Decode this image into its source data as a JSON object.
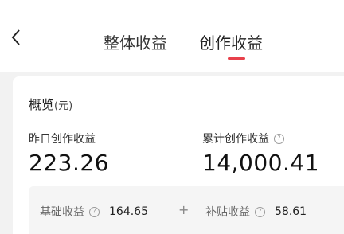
{
  "header": {
    "tabs": [
      {
        "label": "整体收益"
      },
      {
        "label": "创作收益"
      }
    ],
    "active_tab": 1,
    "accent_color": "#e8404b"
  },
  "overview": {
    "title": "概览",
    "unit": "(元)",
    "yesterday_label": "昨日创作收益",
    "yesterday_value": "223.26",
    "total_label": "累计创作收益",
    "total_value": "14,000.41",
    "help_icon": "question-circle-icon"
  },
  "breakdown": {
    "base_label": "基础收益",
    "base_value": "164.65",
    "plus": "+",
    "subsidy_label": "补贴收益",
    "subsidy_value": "58.61"
  }
}
